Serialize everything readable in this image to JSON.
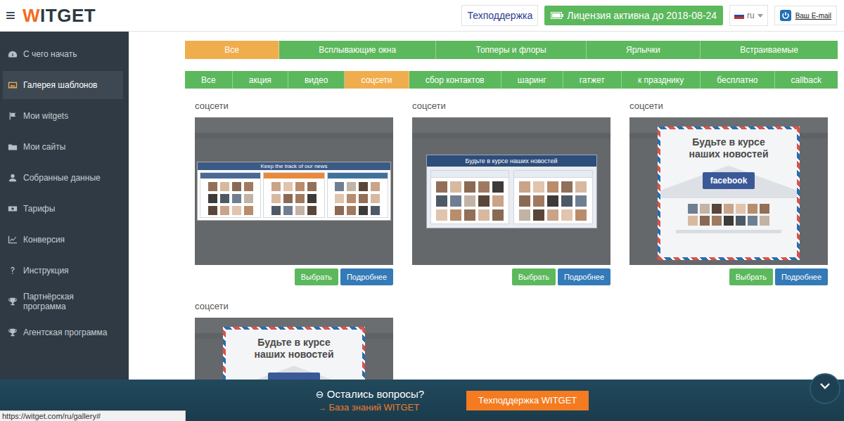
{
  "header": {
    "menu_icon": "≡",
    "logo": {
      "first": "W",
      "rest": "ITGET"
    },
    "support": "Техподдержка",
    "license": "Лицензия активна до 2018-08-24",
    "language": "ru",
    "account": "Ваш E-mail"
  },
  "sidebar": {
    "items": [
      {
        "label": "С чего начать",
        "selected": false
      },
      {
        "label": "Галерея шаблонов",
        "selected": true
      },
      {
        "label": "Мои witgets",
        "selected": false
      },
      {
        "label": "Мои сайты",
        "selected": false
      },
      {
        "label": "Собранные данные",
        "selected": false
      },
      {
        "label": "Тарифы",
        "selected": false
      },
      {
        "label": "Конверсия",
        "selected": false
      },
      {
        "label": "Инструкция",
        "selected": false
      },
      {
        "label": "Партнёрская программа",
        "selected": false
      },
      {
        "label": "Агентская программа",
        "selected": false
      }
    ]
  },
  "filters": {
    "types": [
      {
        "label": "Все",
        "selected": true
      },
      {
        "label": "Всплывающие окна",
        "selected": false
      },
      {
        "label": "Топперы и флоры",
        "selected": false
      },
      {
        "label": "Ярлычки",
        "selected": false
      },
      {
        "label": "Встраиваемые",
        "selected": false
      }
    ],
    "categories": [
      {
        "label": "Все",
        "selected": false
      },
      {
        "label": "акция",
        "selected": false
      },
      {
        "label": "видео",
        "selected": false
      },
      {
        "label": "соцсети",
        "selected": true
      },
      {
        "label": "сбор контактов",
        "selected": false
      },
      {
        "label": "шаринг",
        "selected": false
      },
      {
        "label": "гатжет",
        "selected": false
      },
      {
        "label": "к празднику",
        "selected": false
      },
      {
        "label": "бесплатно",
        "selected": false
      },
      {
        "label": "callback",
        "selected": false
      }
    ]
  },
  "cards": [
    {
      "category": "соцсети",
      "kind": "vk-triple",
      "title": "Keep the track of our news",
      "brand": "",
      "buttons": [
        {
          "label": "Выбрать",
          "kind": "select"
        },
        {
          "label": "Подробнее",
          "kind": "details"
        }
      ]
    },
    {
      "category": "соцсети",
      "kind": "vk-single",
      "title": "Будьте в курсе наших новостей",
      "brand": "",
      "buttons": [
        {
          "label": "Выбрать",
          "kind": "select"
        },
        {
          "label": "Подробнее",
          "kind": "details"
        }
      ]
    },
    {
      "category": "соцсети",
      "kind": "envelope",
      "title": "Будьте в курсе наших новостей",
      "brand": "facebook",
      "buttons": [
        {
          "label": "Выбрать",
          "kind": "select"
        },
        {
          "label": "Подробнее",
          "kind": "details"
        }
      ]
    },
    {
      "category": "соцсети",
      "kind": "envelope",
      "title": "Будьте в курсе наших новостей",
      "brand": "",
      "buttons": []
    }
  ],
  "help_bar": {
    "question_icon": "⊖",
    "question": "Остались вопросы?",
    "link_icon": "→",
    "link": "База знаний WITGET",
    "button": "Техподдержка WITGET"
  },
  "status_url": "https://witget.com/ru/gallery#"
}
